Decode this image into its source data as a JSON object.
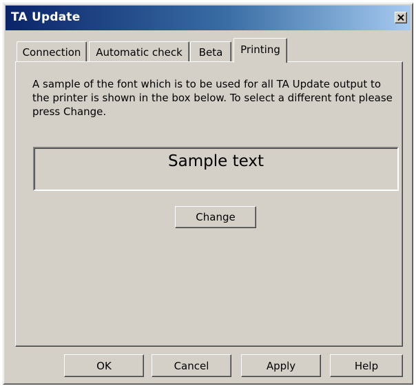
{
  "window": {
    "title": "TA Update",
    "close_glyph": "✕"
  },
  "tabs": [
    {
      "label": "Connection",
      "active": false
    },
    {
      "label": "Automatic check",
      "active": false
    },
    {
      "label": "Beta",
      "active": false
    },
    {
      "label": "Printing",
      "active": true
    }
  ],
  "printing": {
    "description": "A sample of the font which is to be used for all TA Update output to the printer is shown in the box below. To select a different font please press Change.",
    "sample_text": "Sample text",
    "change_label": "Change"
  },
  "buttons": {
    "ok_label": "OK",
    "cancel_label": "Cancel",
    "apply_label": "Apply",
    "help_label": "Help"
  },
  "colors": {
    "face": "#d4d0c8",
    "titlebar_start": "#0a246a",
    "titlebar_end": "#a6caf0"
  }
}
